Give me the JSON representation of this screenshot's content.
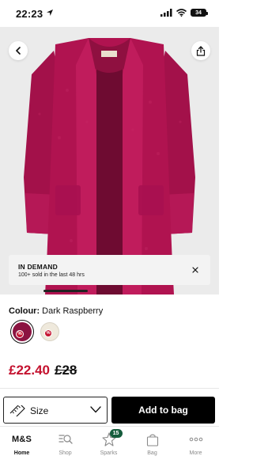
{
  "status_bar": {
    "time": "22:23",
    "battery": "34"
  },
  "hero": {
    "image_alt": "Dark raspberry fleece cardigan coat",
    "colors": {
      "garment": "#b01350",
      "background": "#ebebeb"
    }
  },
  "demand_banner": {
    "title": "IN DEMAND",
    "subtitle": "100+ sold in the last 48 hrs"
  },
  "product": {
    "colour_label": "Colour:",
    "colour_value": "Dark Raspberry",
    "swatches": [
      {
        "color": "#8b1341",
        "selected": true,
        "sale_badge": "%"
      },
      {
        "color": "#efe9dc",
        "selected": false,
        "sale_badge": "%"
      }
    ],
    "price_now": "£22.40",
    "price_was": "£28"
  },
  "actions": {
    "size_label": "Size",
    "add_to_bag_label": "Add to bag"
  },
  "tabbar": {
    "items": [
      {
        "label": "Home",
        "brand": "M&S",
        "active": true
      },
      {
        "label": "Shop",
        "icon": "search-list-icon"
      },
      {
        "label": "Sparks",
        "icon": "sparks-star-icon",
        "badge": "15"
      },
      {
        "label": "Bag",
        "icon": "bag-icon"
      },
      {
        "label": "More",
        "icon": "more-dots-icon"
      }
    ]
  },
  "colors": {
    "accent_price": "#c4122f",
    "sparks_badge": "#155c3c",
    "primary_button": "#000000"
  }
}
